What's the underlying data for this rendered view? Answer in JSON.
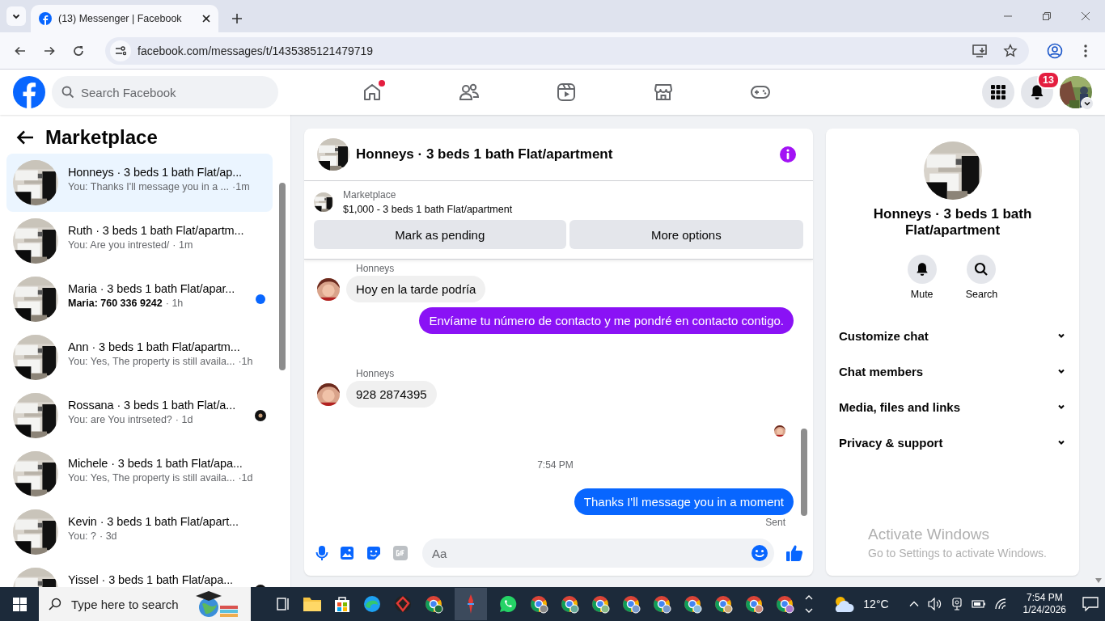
{
  "browser": {
    "tab_title": "(13) Messenger | Facebook",
    "url": "facebook.com/messages/t/1435385121479719"
  },
  "header": {
    "search_placeholder": "Search Facebook",
    "home_has_new": true,
    "notifications_badge": "13"
  },
  "sidebar": {
    "title": "Marketplace",
    "conversations": [
      {
        "name": "Honneys · 3 beds 1 bath Flat/ap...",
        "preview": "You: Thanks I'll message you in a ...",
        "time": "·1m",
        "selected": true,
        "unread": false,
        "seen": false
      },
      {
        "name": "Ruth · 3 beds 1 bath Flat/apartm...",
        "preview": "You: Are you intrested/",
        "time": "· 1m",
        "selected": false,
        "unread": false,
        "seen": false
      },
      {
        "name": "Maria · 3 beds 1 bath Flat/apar...",
        "preview": "Maria: 760 336 9242",
        "time": "· 1h",
        "selected": false,
        "unread": true,
        "seen": false
      },
      {
        "name": "Ann · 3 beds 1 bath Flat/apartm...",
        "preview": "You: Yes, The property is still availa...",
        "time": "·1h",
        "selected": false,
        "unread": false,
        "seen": false
      },
      {
        "name": "Rossana · 3 beds 1 bath Flat/a...",
        "preview": "You: are You intrseted?",
        "time": "· 1d",
        "selected": false,
        "unread": false,
        "seen": true
      },
      {
        "name": "Michele · 3 beds 1 bath Flat/apa...",
        "preview": "You: Yes, The property is still availa...",
        "time": "·1d",
        "selected": false,
        "unread": false,
        "seen": false
      },
      {
        "name": "Kevin · 3 beds 1 bath Flat/apart...",
        "preview": "You: ?",
        "time": "· 3d",
        "selected": false,
        "unread": false,
        "seen": false
      },
      {
        "name": "Yissel · 3 beds 1 bath Flat/apa...",
        "selected": false,
        "unread": false,
        "seen": true
      }
    ]
  },
  "chat": {
    "title": "Honneys · 3 beds 1 bath Flat/apartment",
    "listing": {
      "label": "Marketplace",
      "description": "$1,000 - 3 beds 1 bath Flat/apartment",
      "buttons": [
        "Mark as pending",
        "More options"
      ]
    },
    "messages": [
      {
        "kind": "sender",
        "text": "Honneys"
      },
      {
        "kind": "incoming",
        "text": "Hoy en la tarde podría"
      },
      {
        "kind": "outgoing",
        "text": "Envíame tu número de contacto y me pondré en contacto contigo.",
        "color": "#8a12f5"
      },
      {
        "kind": "sender",
        "text": "Honneys"
      },
      {
        "kind": "incoming",
        "text": "928 2874395"
      },
      {
        "kind": "seen"
      },
      {
        "kind": "timestamp",
        "text": "7:54 PM"
      },
      {
        "kind": "outgoing",
        "text": "Thanks I'll message you in a moment",
        "color": "#0866ff"
      },
      {
        "kind": "status",
        "text": "Sent"
      }
    ],
    "composer_placeholder": "Aa"
  },
  "details": {
    "title": "Honneys · 3 beds 1 bath Flat/apartment",
    "actions": [
      {
        "kind": "mute",
        "label": "Mute"
      },
      {
        "kind": "search",
        "label": "Search"
      }
    ],
    "sections": [
      {
        "label": "Customize chat",
        "expanded": false
      },
      {
        "label": "Chat members",
        "expanded": false
      },
      {
        "label": "Media, files and links",
        "expanded": false
      },
      {
        "label": "Privacy & support",
        "expanded": false
      }
    ]
  },
  "activation_notice": {
    "title": "Activate Windows",
    "hint": "Go to Settings to activate Windows."
  },
  "taskbar": {
    "search_placeholder": "Type here to search",
    "temperature": "12°C",
    "time": "7:54 PM",
    "date": "1/24/2026"
  }
}
